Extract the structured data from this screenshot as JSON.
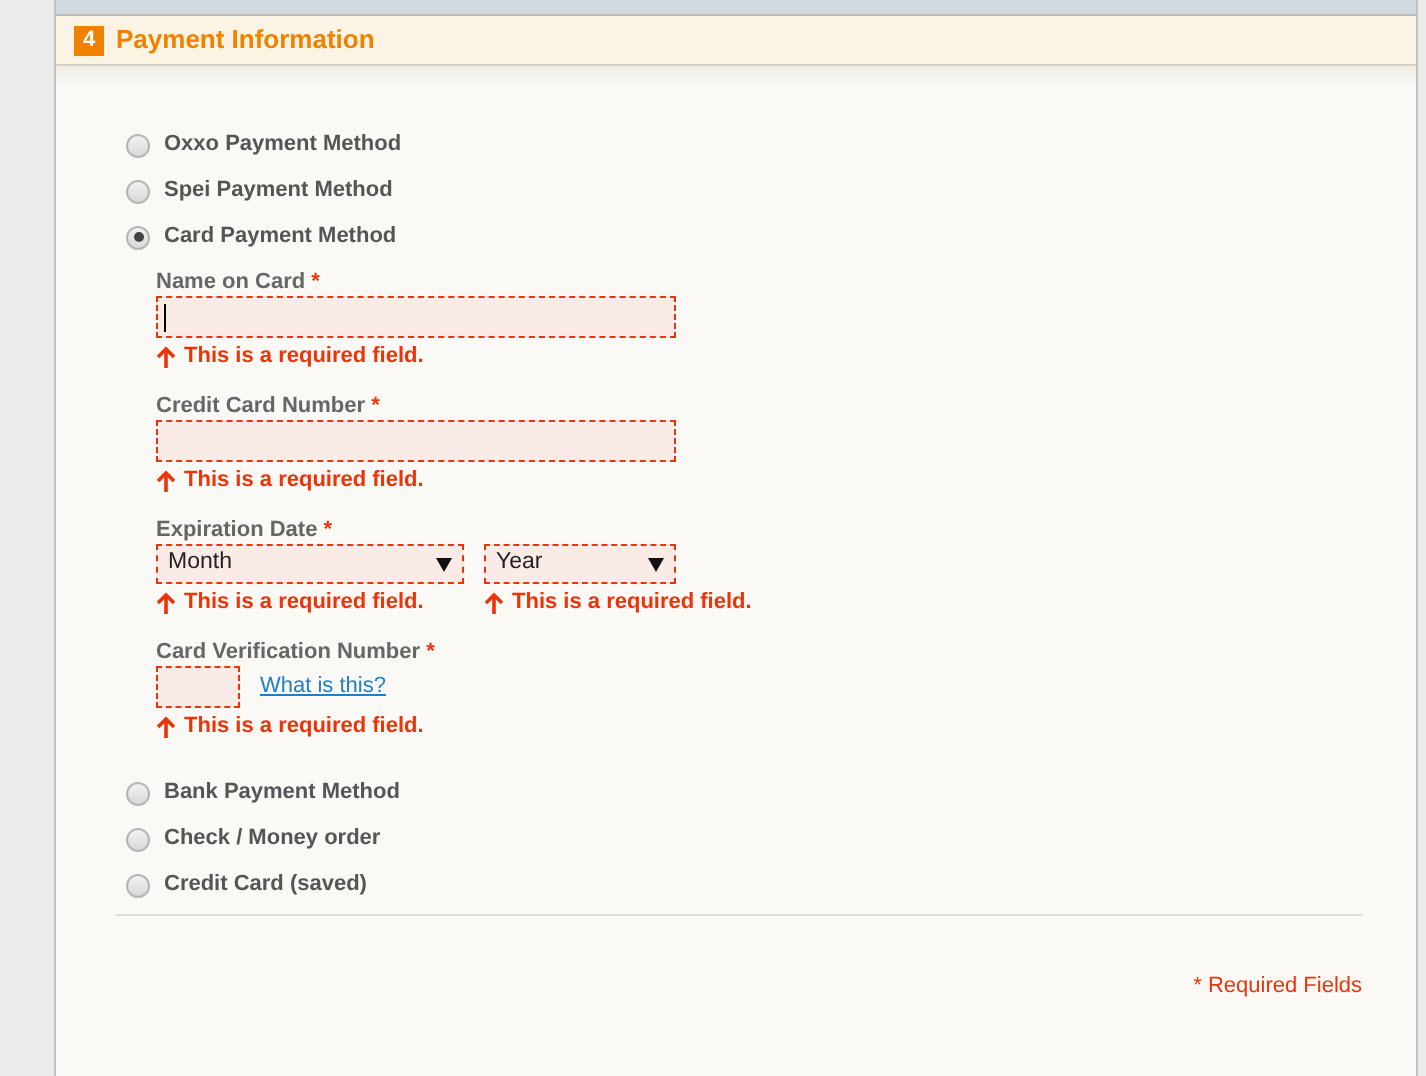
{
  "section": {
    "step": "4",
    "title": "Payment Information"
  },
  "payment_methods": [
    {
      "label": "Oxxo Payment Method",
      "selected": false
    },
    {
      "label": "Spei Payment Method",
      "selected": false
    },
    {
      "label": "Card Payment Method",
      "selected": true,
      "form": [
        {
          "kind": "text",
          "label": "Name on Card",
          "required_mark": "*",
          "focused": true,
          "error": "This is a required field."
        },
        {
          "kind": "text",
          "label": "Credit Card Number",
          "required_mark": "*",
          "error": "This is a required field."
        },
        {
          "kind": "selects",
          "label": "Expiration Date",
          "required_mark": "*",
          "selects": [
            {
              "value": "Month",
              "error": "This is a required field."
            },
            {
              "value": "Year",
              "error": "This is a required field."
            }
          ]
        },
        {
          "kind": "cvv",
          "label": "Card Verification Number",
          "required_mark": "*",
          "link": "What is this?",
          "error": "This is a required field."
        }
      ]
    },
    {
      "label": "Bank Payment Method",
      "selected": false
    },
    {
      "label": "Check / Money order",
      "selected": false
    },
    {
      "label": "Credit Card (saved)",
      "selected": false
    }
  ],
  "footer_note": "* Required Fields"
}
